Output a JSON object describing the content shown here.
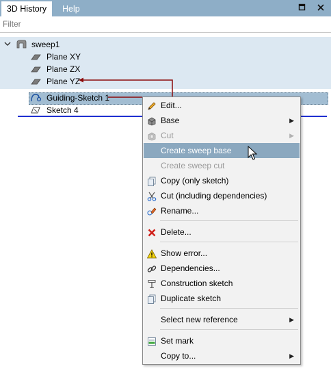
{
  "tabs": {
    "history": "3D History",
    "help": "Help"
  },
  "window_buttons": {
    "restore_icon": "window-restore-icon",
    "close_icon": "close-icon"
  },
  "filter": {
    "placeholder": "Filter",
    "value": ""
  },
  "tree": {
    "root": "sweep1",
    "planes": [
      "Plane XY",
      "Plane ZX",
      "Plane YZ"
    ],
    "selected": "Guiding-Sketch 1",
    "sketch4": "Sketch 4"
  },
  "colors": {
    "tabbar": "#8eaec7",
    "tree_highlight": "#dce8f2",
    "selected_row": "#a2bdd2",
    "menu_hover": "#8ba8bf",
    "arrow": "#8b0a0a",
    "insert_line": "#1f2fd1"
  },
  "menu": {
    "edit": "Edit...",
    "base": "Base",
    "cut": "Cut",
    "create_sweep_base": "Create sweep base",
    "create_sweep_cut": "Create sweep cut",
    "copy_only_sketch": "Copy (only sketch)",
    "cut_incl_deps": "Cut (including dependencies)",
    "rename": "Rename...",
    "delete": "Delete...",
    "show_error": "Show error...",
    "dependencies": "Dependencies...",
    "construction_sketch": "Construction sketch",
    "duplicate_sketch": "Duplicate sketch",
    "select_new_reference": "Select new reference",
    "set_mark": "Set mark",
    "copy_to": "Copy to..."
  }
}
